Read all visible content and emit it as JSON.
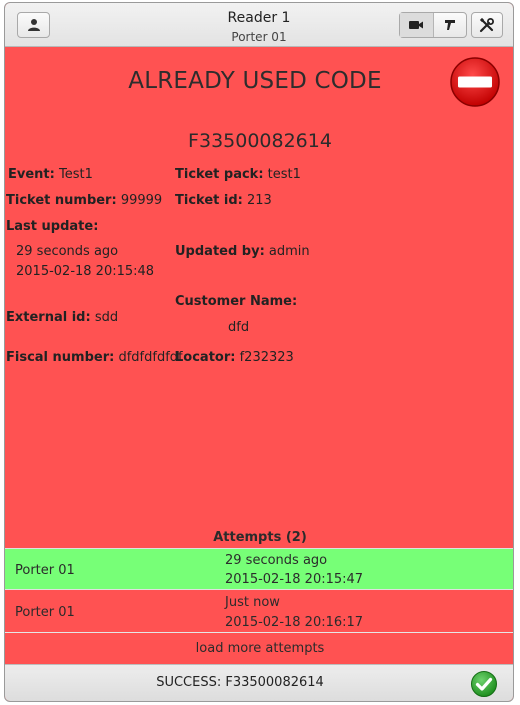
{
  "header": {
    "title": "Reader 1",
    "subtitle": "Porter 01"
  },
  "status": {
    "title": "ALREADY USED CODE",
    "code": "F33500082614"
  },
  "fields": {
    "event_label": "Event:",
    "event_value": "Test1",
    "ticket_pack_label": "Ticket pack:",
    "ticket_pack_value": "test1",
    "ticket_number_label": "Ticket number:",
    "ticket_number_value": "99999",
    "ticket_id_label": "Ticket id:",
    "ticket_id_value": "213",
    "last_update_label": "Last update:",
    "last_update_relative": "29 seconds ago",
    "last_update_datetime": "2015-02-18 20:15:48",
    "updated_by_label": "Updated by:",
    "updated_by_value": "admin",
    "customer_name_label": "Customer Name:",
    "customer_name_value": "dfd",
    "external_id_label": "External id:",
    "external_id_value": "sdd",
    "fiscal_number_label": "Fiscal number:",
    "fiscal_number_value": "dfdfdfdfdf",
    "locator_label": "Locator:",
    "locator_value": "f232323"
  },
  "attempts": {
    "title": "Attempts (2)",
    "rows": [
      {
        "who": "Porter 01",
        "relative": "29 seconds ago",
        "datetime": "2015-02-18 20:15:47",
        "status": "success"
      },
      {
        "who": "Porter 01",
        "relative": "Just now",
        "datetime": "2015-02-18 20:16:17",
        "status": "failed"
      }
    ],
    "load_more": "load more attempts"
  },
  "footer": {
    "text": "SUCCESS: F33500082614"
  },
  "colors": {
    "error_background": "#ff5252",
    "success_row": "#77ff77"
  },
  "icons": [
    "user-icon",
    "camera-icon",
    "scanner-icon",
    "tools-icon",
    "stop-icon",
    "check-icon"
  ]
}
